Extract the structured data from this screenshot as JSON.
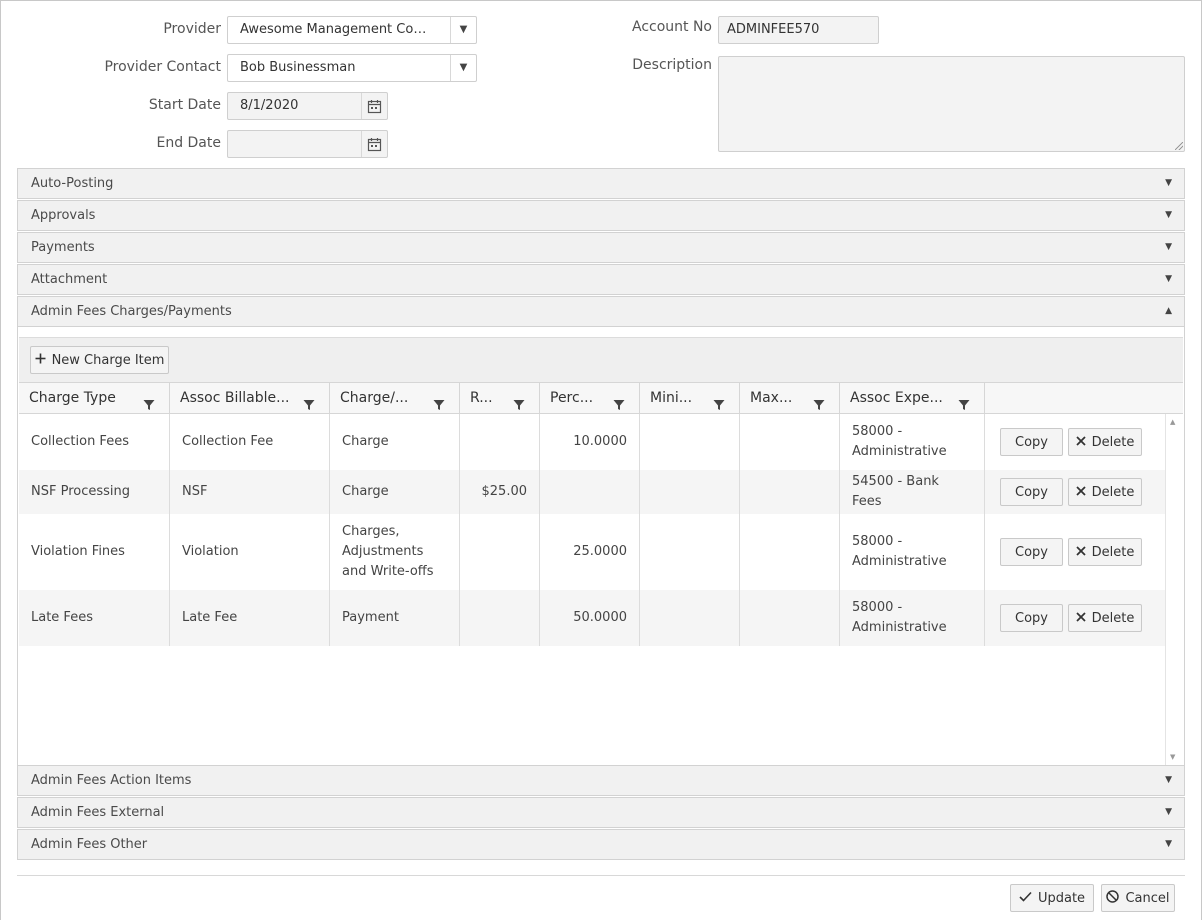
{
  "form": {
    "provider_label": "Provider",
    "provider_value": "Awesome Management Company",
    "contact_label": "Provider Contact",
    "contact_value": "Bob Businessman",
    "start_label": "Start Date",
    "start_value": "8/1/2020",
    "end_label": "End Date",
    "end_value": "",
    "account_label": "Account No",
    "account_value": "ADMINFEE570",
    "description_label": "Description",
    "description_value": ""
  },
  "panels": {
    "auto_posting": "Auto-Posting",
    "approvals": "Approvals",
    "payments": "Payments",
    "attachment": "Attachment",
    "charges": "Admin Fees Charges/Payments",
    "action_items": "Admin Fees Action Items",
    "external": "Admin Fees External",
    "other": "Admin Fees Other"
  },
  "grid": {
    "new_item_label": "New Charge Item",
    "columns": [
      "Charge Type",
      "Assoc Billable...",
      "Charge/...",
      "R...",
      "Perc...",
      "Mini...",
      "Max...",
      "Assoc Expe..."
    ],
    "rows": [
      {
        "type": "Collection Fees",
        "billable": "Collection Fee",
        "charge": "Charge",
        "rate": "",
        "percent": "10.0000",
        "min": "",
        "max": "",
        "expense": "58000 - Administrative"
      },
      {
        "type": "NSF Processing",
        "billable": "NSF",
        "charge": "Charge",
        "rate": "$25.00",
        "percent": "",
        "min": "",
        "max": "",
        "expense": "54500 - Bank Fees"
      },
      {
        "type": "Violation Fines",
        "billable": "Violation",
        "charge": "Charges, Adjustments and Write-offs",
        "rate": "",
        "percent": "25.0000",
        "min": "",
        "max": "",
        "expense": "58000 - Administrative"
      },
      {
        "type": "Late Fees",
        "billable": "Late Fee",
        "charge": "Payment",
        "rate": "",
        "percent": "50.0000",
        "min": "",
        "max": "",
        "expense": "58000 - Administrative"
      }
    ],
    "copy_label": "Copy",
    "delete_label": "Delete"
  },
  "footer": {
    "update_label": "Update",
    "cancel_label": "Cancel"
  },
  "icons": {
    "dropdown": "dropdown-arrow-icon",
    "calendar": "calendar-icon",
    "filter": "filter-icon",
    "plus": "plus-icon",
    "close": "close-x-icon",
    "check": "check-icon",
    "cancel": "cancel-circle-icon"
  }
}
